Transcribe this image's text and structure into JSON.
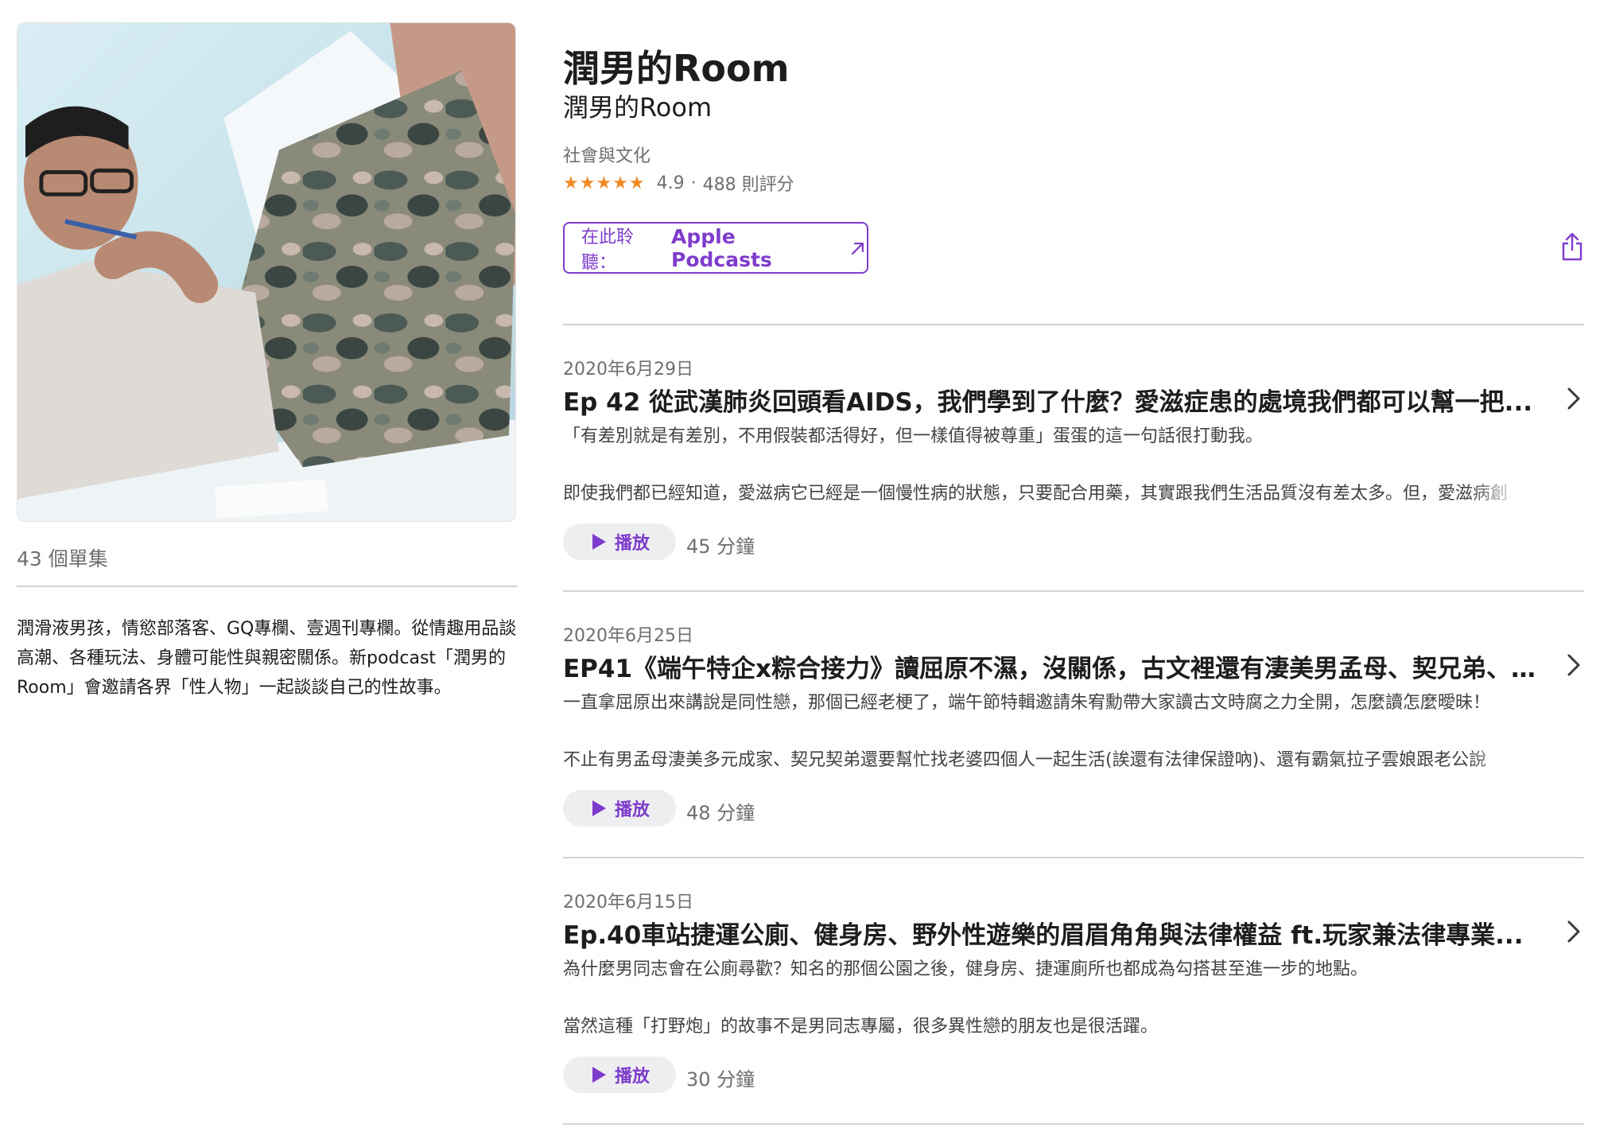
{
  "podcast": {
    "title": "潤男的Room",
    "author": "潤男的Room",
    "category": "社會與文化",
    "rating_value": "4.9",
    "rating_separator": "·",
    "rating_count": "488 則評分",
    "stars": "★★★★★",
    "episode_count": "43 個單集",
    "description": "潤滑液男孩，情慾部落客、GQ專欄、壹週刊專欄。從情趣用品談高潮、各種玩法、身體可能性與親密關係。新podcast「潤男的Room」會邀請各界「性人物」一起談談自己的性故事。"
  },
  "listen_button": {
    "prefix": "在此聆聽：",
    "app": "Apple Podcasts"
  },
  "icons": {
    "share": "share-icon",
    "external": "arrow-up-right-icon",
    "play": "play-icon",
    "chevron": "chevron-right-icon",
    "stars": "star-icon"
  },
  "colors": {
    "accent": "#7e3ccc",
    "stars": "#f08a24",
    "secondary_text": "#6e6e73"
  },
  "episodes": [
    {
      "date": "2020年6月29日",
      "title": "Ep 42 從武漢肺炎回頭看AIDS，我們學到了什麼？愛滋症患的處境我們都可以幫一把...",
      "desc1": "「有差別就是有差別，不用假裝都活得好，但一樣值得被尊重」蛋蛋的這一句話很打動我。",
      "desc2": "即使我們都已經知道，愛滋病它已經是一個慢性病的狀態，只要配合用藥，其實跟我們生活品質沒有差太多。但，愛滋病創",
      "play_label": "播放",
      "duration": "45 分鐘"
    },
    {
      "date": "2020年6月25日",
      "title": "EP41《端午特企x粽合接力》讀屈原不濕，沒關係，古文裡還有淒美男孟母、契兄弟、霸...",
      "desc1": "一直拿屈原出來講說是同性戀，那個已經老梗了，端午節特輯邀請朱宥勳帶大家讀古文時腐之力全開，怎麼讀怎麼曖昧！",
      "desc2": "不止有男孟母淒美多元成家、契兄契弟還要幫忙找老婆四個人一起生活(誒還有法律保證吶)、還有霸氣拉子雲娘跟老公說",
      "play_label": "播放",
      "duration": "48 分鐘"
    },
    {
      "date": "2020年6月15日",
      "title": "Ep.40車站捷運公廁、健身房、野外性遊樂的眉眉角角與法律權益 ft.玩家兼法律專業...",
      "desc1": "為什麼男同志會在公廁尋歡？知名的那個公園之後，健身房、捷運廁所也都成為勾搭甚至進一步的地點。",
      "desc2": "當然這種「打野炮」的故事不是男同志專屬，很多異性戀的朋友也是很活躍。",
      "play_label": "播放",
      "duration": "30 分鐘"
    }
  ]
}
